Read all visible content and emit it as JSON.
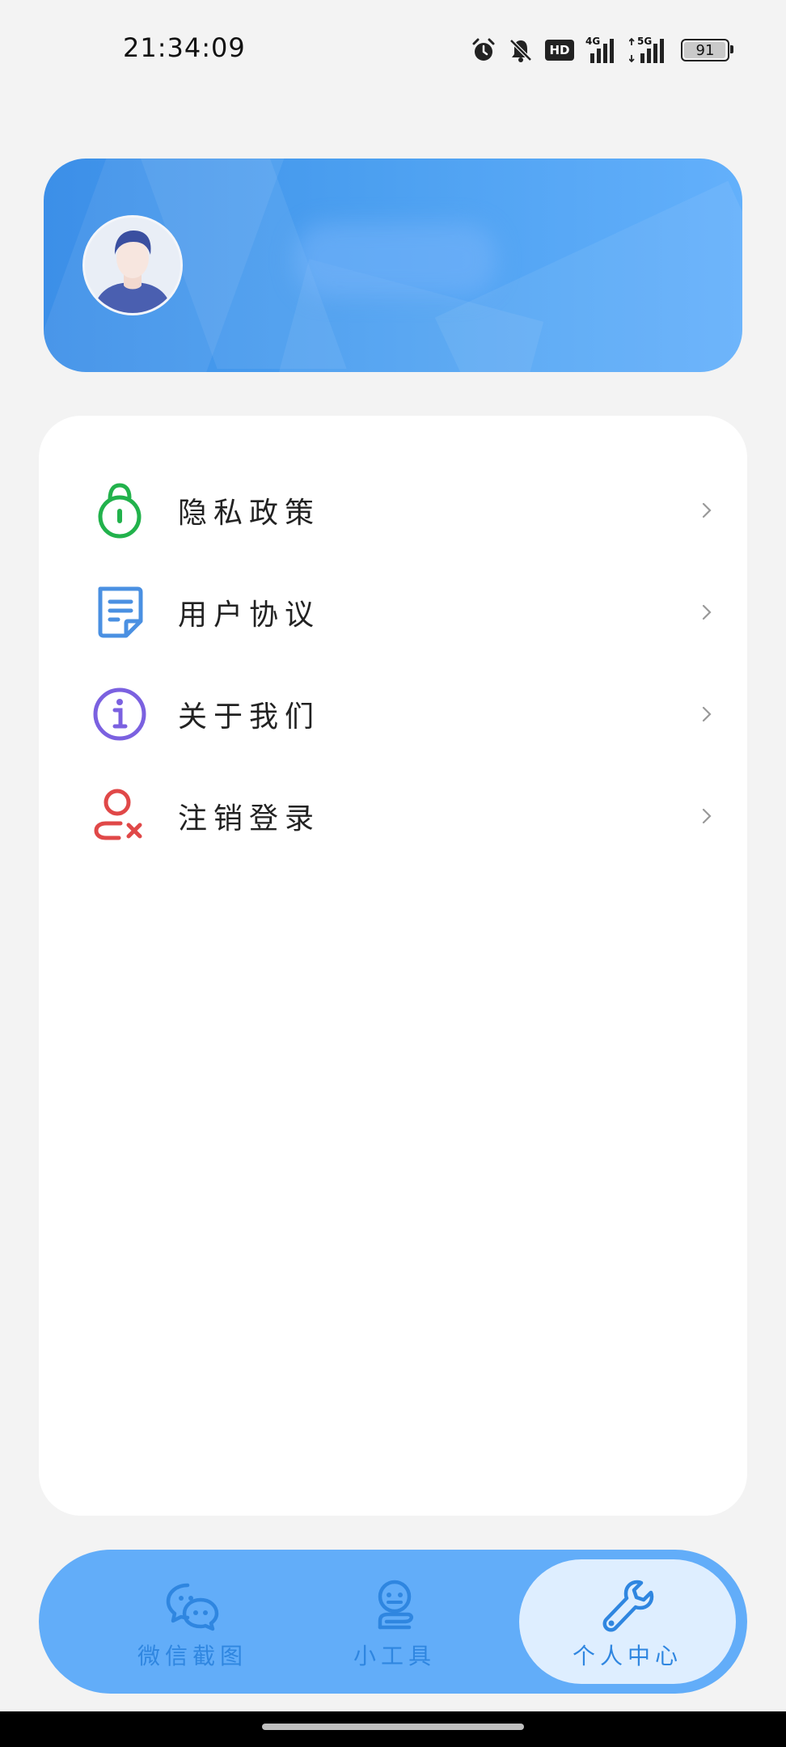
{
  "status_bar": {
    "time": "21:34:09",
    "hd_badge": "HD",
    "network_1": "4G",
    "network_2": "5G",
    "battery_level": "91"
  },
  "profile": {
    "avatar_icon": "user-avatar"
  },
  "menu": {
    "items": [
      {
        "label": "隐私政策",
        "icon": "lock-icon",
        "color": "#22b24c"
      },
      {
        "label": "用户协议",
        "icon": "document-icon",
        "color": "#4a90e2"
      },
      {
        "label": "关于我们",
        "icon": "info-icon",
        "color": "#7b61e0"
      },
      {
        "label": "注销登录",
        "icon": "user-remove-icon",
        "color": "#e04848"
      }
    ]
  },
  "bottom_nav": {
    "items": [
      {
        "label": "微信截图",
        "icon": "chat-bubbles-icon",
        "active": false
      },
      {
        "label": "小工具",
        "icon": "robot-icon",
        "active": false
      },
      {
        "label": "个人中心",
        "icon": "wrench-icon",
        "active": true
      }
    ]
  },
  "colors": {
    "accent": "#62adf9",
    "active_tab_bg": "#deeeff",
    "nav_text": "#2f86e0"
  }
}
